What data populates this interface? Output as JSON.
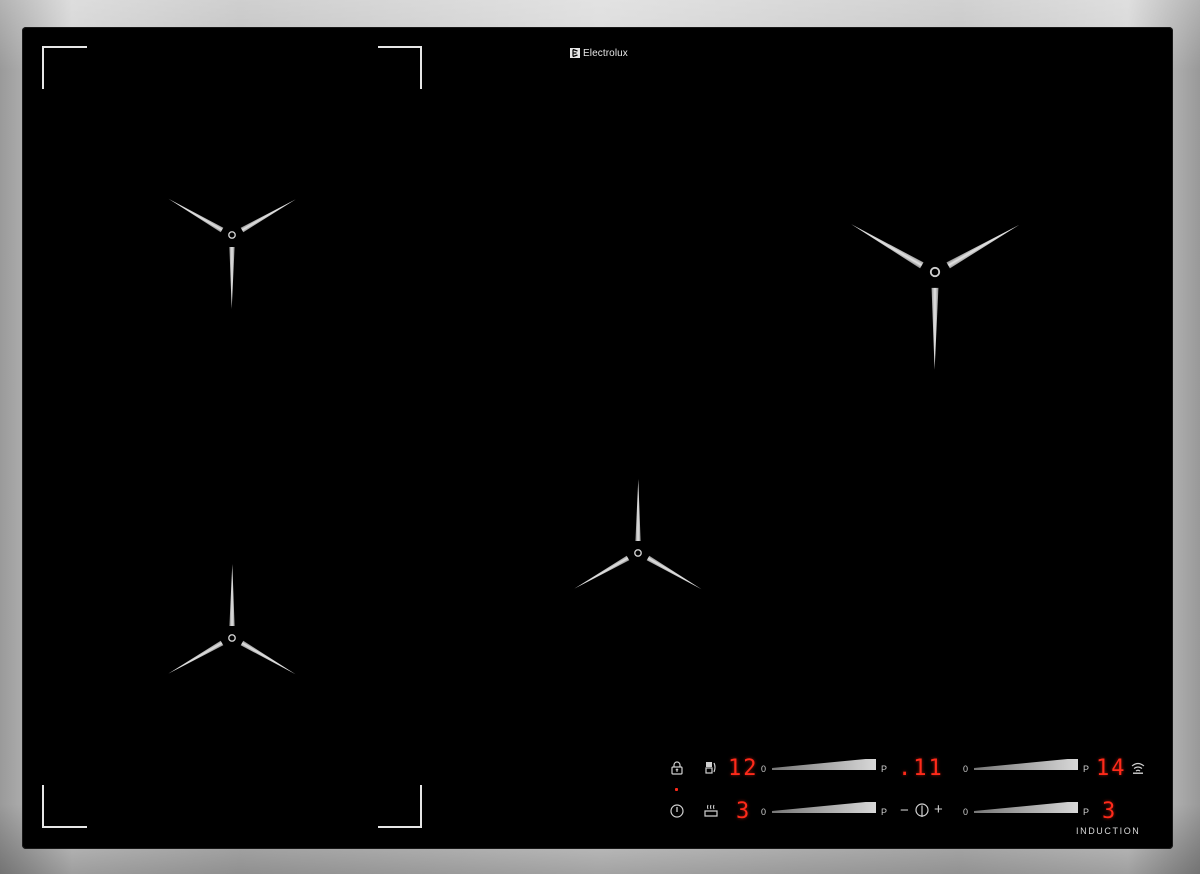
{
  "brand": {
    "name": "Electrolux",
    "tagline": "INDUCTION"
  },
  "colors": {
    "frame": "#c9c9c9",
    "glass": "#000000",
    "marking": "#d0d0d0",
    "display_red": "#ff2a1a"
  },
  "zones": [
    {
      "name": "front-left-zone",
      "icon": "tri-prong-zone-marker"
    },
    {
      "name": "rear-left-zone",
      "icon": "tri-prong-zone-marker"
    },
    {
      "name": "center-zone",
      "icon": "tri-prong-zone-marker"
    },
    {
      "name": "rear-right-zone",
      "icon": "tri-prong-zone-marker"
    }
  ],
  "controls": {
    "row1": {
      "lock_icon": "lock-icon",
      "bridge_icon": "bridge-icon",
      "display_left": "12",
      "slider_left": {
        "min_label": "0",
        "max_label": "P"
      },
      "display_mid": ".11",
      "slider_right": {
        "min_label": "0",
        "max_label": "P"
      },
      "display_right": "14",
      "hob2hood_icon": "wireless-icon"
    },
    "row2": {
      "power_icon": "power-icon",
      "pot_icon": "pot-boil-icon",
      "display_left": "3",
      "slider_left": {
        "min_label": "0",
        "max_label": "P"
      },
      "timer": {
        "minus": "−",
        "plus": "+",
        "icon": "timer-icon"
      },
      "slider_right": {
        "min_label": "0",
        "max_label": "P"
      },
      "display_right": "3"
    }
  }
}
